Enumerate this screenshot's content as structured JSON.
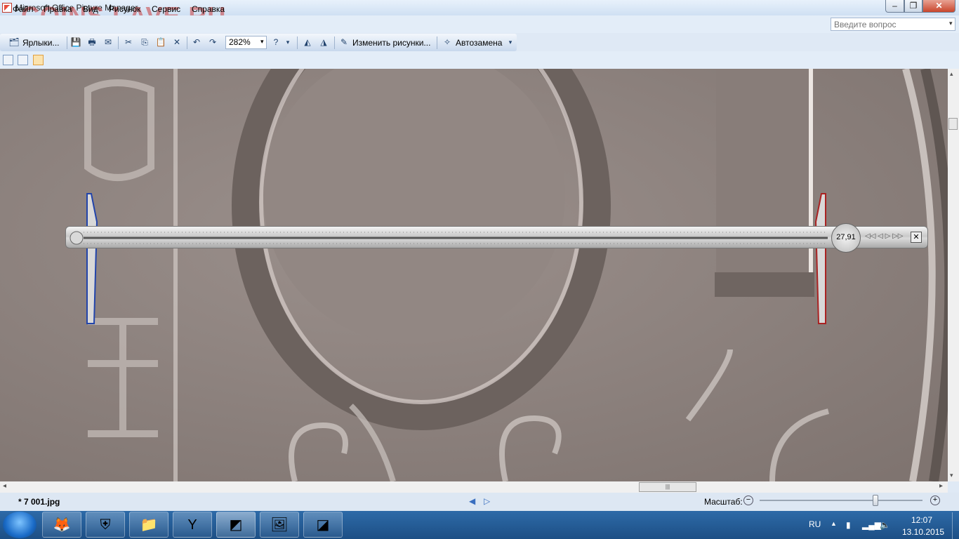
{
  "window": {
    "title": "Microsoft Office Picture Manager",
    "watermark": "COINS.LAVE.RU",
    "min_symbol": "–",
    "max_symbol": "❐",
    "close_symbol": "✕"
  },
  "menu": {
    "items": [
      "Файл",
      "Правка",
      "Вид",
      "Рисунок",
      "Сервис",
      "Справка"
    ],
    "help_placeholder": "Введите вопрос",
    "help_arrow": "▾"
  },
  "toolbar": {
    "shortcuts_label": "Ярлыки...",
    "zoom_value": "282%",
    "edit_pictures_label": "Изменить рисунки...",
    "autocorrect_label": "Автозамена",
    "dropdown_arrow": "▾"
  },
  "caliper": {
    "value": "27,91"
  },
  "status": {
    "file_name": "* 7 001.jpg",
    "zoom_label": "Масштаб:",
    "zoom_level": 0.71
  },
  "scroll": {
    "grip": "|||",
    "left_arrow": "◂",
    "right_arrow": "▸",
    "up_arrow": "▴",
    "down_arrow": "▾",
    "prev_arrow": "◀",
    "next_arrow": "▷"
  },
  "taskbar": {
    "language": "RU",
    "time": "12:07",
    "date": "13.10.2015",
    "tray_up": "▲"
  },
  "colors": {
    "coin": "#8f8480",
    "taskbar": "#1d4f85",
    "accent": "#c0392b"
  }
}
